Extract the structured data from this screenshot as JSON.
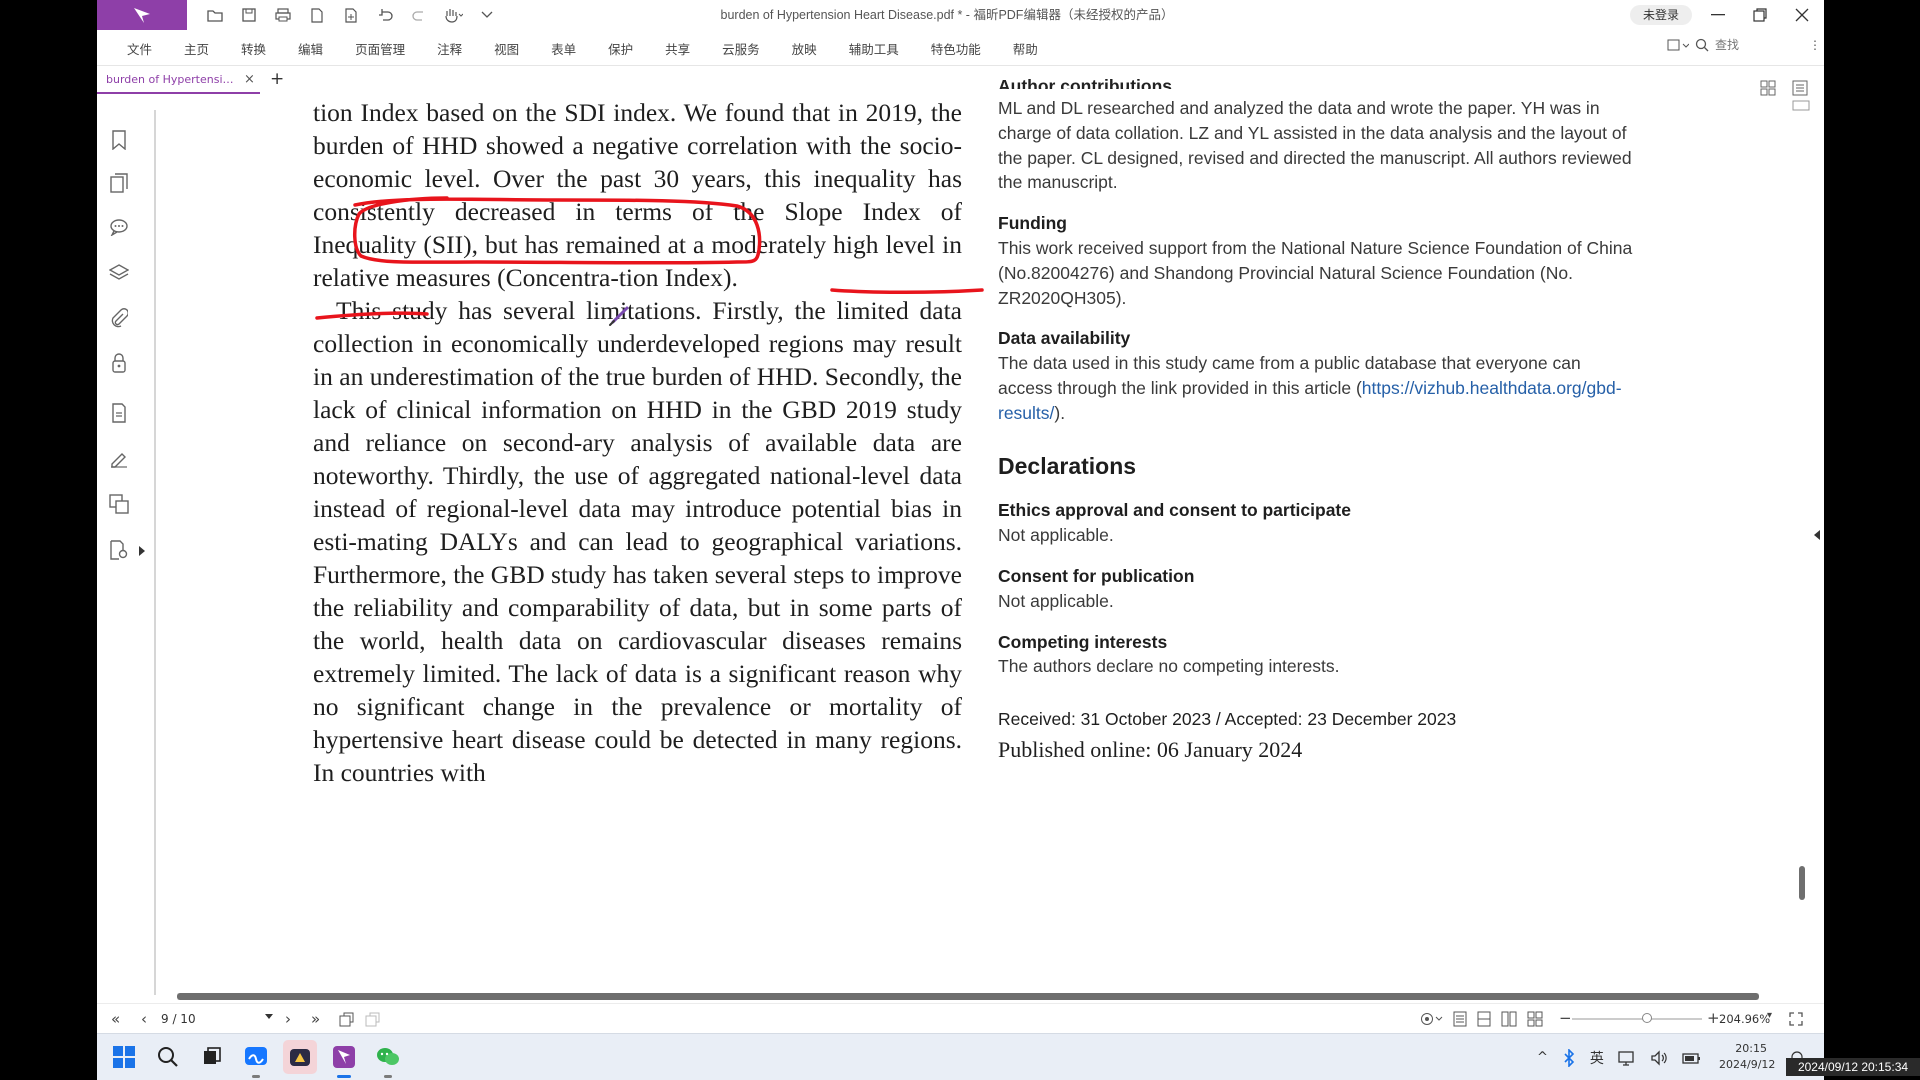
{
  "app": {
    "window_title": "burden of Hypertension Heart Disease.pdf * - 福昕PDF编辑器（未经授权的产品）",
    "login_label": "未登录",
    "colors": {
      "brand": "#8e3fa8",
      "annotation": "#e8141c",
      "link": "#2660a8"
    }
  },
  "menu": {
    "items": [
      "文件",
      "主页",
      "转换",
      "编辑",
      "页面管理",
      "注释",
      "视图",
      "表单",
      "保护",
      "共享",
      "云服务",
      "放映",
      "辅助工具",
      "特色功能",
      "帮助"
    ],
    "search_placeholder": "查找"
  },
  "tab": {
    "label": "burden of Hypertension..."
  },
  "document": {
    "left": {
      "p1": "tion Index based on the SDI index. We found that in 2019, the burden of HHD showed a negative correlation with the socio-economic level. Over the past 30 years, this inequality has consistently decreased in terms of the Slope Index of Inequality (SII), but has remained at a moderately high level in relative measures (Concentra-tion Index).",
      "p2": "This study has several limitations. Firstly, the limited data collection in economically underdeveloped regions may result in an underestimation of the true burden of HHD. Secondly, the lack of clinical information on HHD in the GBD 2019 study and reliance on second-ary analysis of available data are noteworthy. Thirdly, the use of aggregated national-level data instead of regional-level data may introduce potential bias in esti-mating DALYs and can lead to geographical variations. Furthermore, the GBD study has taken several steps to improve the reliability and comparability of data, but in some parts of the world, health data on cardiovascular diseases remains extremely limited. The lack of data is a significant reason why no significant change in the prevalence or mortality of hypertensive heart disease could be detected in many regions. In countries with"
    },
    "right": {
      "cut_heading": "Author contributions",
      "author_contributions": "ML and DL researched and analyzed the data and wrote the paper. YH was in charge of data collation. LZ and YL assisted in the data analysis and the layout of the paper. CL designed, revised and directed the manuscript. All authors reviewed the manuscript.",
      "funding_heading": "Funding",
      "funding_text": "This work received support from the National Nature Science Foundation of China (No.82004276) and Shandong Provincial Natural Science Foundation (No. ZR2020QH305).",
      "data_heading": "Data availability",
      "data_text": "The data used in this study came from a public database that everyone can access through the link provided in this article (",
      "data_link": "https://vizhub.healthdata.org/gbd-results/",
      "data_text_end": ").",
      "declarations": "Declarations",
      "ethics_heading": "Ethics approval and consent to participate",
      "ethics_text": "Not applicable.",
      "consent_heading": "Consent for publication",
      "consent_text": "Not applicable.",
      "competing_heading": "Competing interests",
      "competing_text": "The authors declare no competing interests.",
      "dates": "Received: 31 October 2023 / Accepted: 23 December 2023",
      "published": "Published online: 06 January 2024"
    }
  },
  "status": {
    "page": "9 / 10",
    "zoom": "204.96%"
  },
  "taskbar": {
    "time": "20:15",
    "date": "2024/9/12",
    "ime": "英"
  },
  "overlay_timestamp": "2024/09/12 20:15:34"
}
